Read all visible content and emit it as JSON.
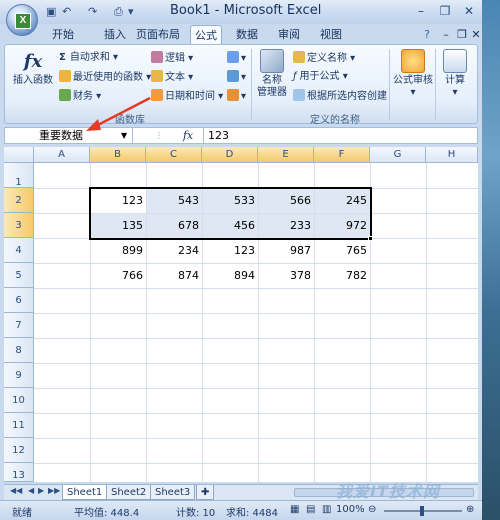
{
  "window": {
    "title": "Book1 - Microsoft Excel"
  },
  "qat": {
    "undo": "↶",
    "redo": "↷"
  },
  "tabs": [
    "开始",
    "插入",
    "页面布局",
    "公式",
    "数据",
    "审阅",
    "视图"
  ],
  "active_tab": "公式",
  "ribbon": {
    "insert_function": "插入函数",
    "autosum": "自动求和",
    "recent": "最近使用的函数",
    "financial": "财务",
    "logical": "逻辑",
    "text": "文本",
    "datetime": "日期和时间",
    "group_library": "函数库",
    "name_manager_l1": "名称",
    "name_manager_l2": "管理器",
    "define_name": "定义名称",
    "use_in_formula": "用于公式",
    "create_from_sel": "根据所选内容创建",
    "group_names": "定义的名称",
    "formula_audit": "公式审核",
    "calculation": "计算"
  },
  "formula_bar": {
    "name_box": "重要数据",
    "fx": "fx",
    "value": "123"
  },
  "columns": [
    "A",
    "B",
    "C",
    "D",
    "E",
    "F",
    "G",
    "H"
  ],
  "rows": [
    "1",
    "2",
    "3",
    "4",
    "5",
    "6",
    "7",
    "8",
    "9",
    "10",
    "11",
    "12",
    "13"
  ],
  "cells": {
    "r2": [
      "123",
      "543",
      "533",
      "566",
      "245"
    ],
    "r3": [
      "135",
      "678",
      "456",
      "233",
      "972"
    ],
    "r4": [
      "899",
      "234",
      "123",
      "987",
      "765"
    ],
    "r5": [
      "766",
      "874",
      "894",
      "378",
      "782"
    ]
  },
  "sheets": [
    "Sheet1",
    "Sheet2",
    "Sheet3"
  ],
  "active_sheet": "Sheet1",
  "status": {
    "ready": "就绪",
    "average": "平均值: 448.4",
    "count": "计数: 10",
    "sum": "求和: 4484",
    "zoom": "100%"
  },
  "watermark": "我爱IT技术网",
  "colors": {
    "arrow": "#e53a26",
    "selection": "#000000",
    "header_selected": "#f6c86b"
  }
}
